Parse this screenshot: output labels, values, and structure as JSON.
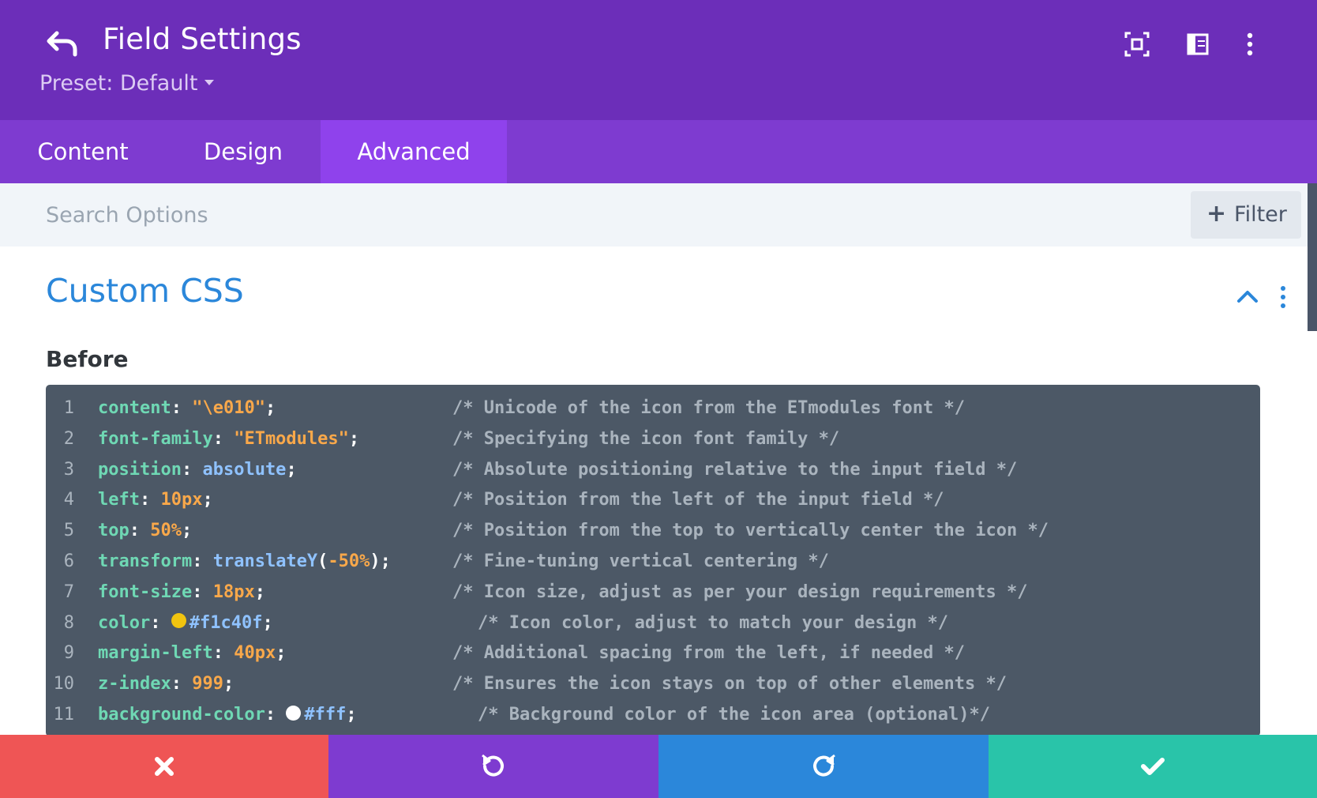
{
  "header": {
    "title": "Field Settings",
    "preset": "Preset: Default",
    "icons": [
      "back-icon",
      "focus-icon",
      "layout-icon",
      "more-icon"
    ]
  },
  "tabs": [
    {
      "label": "Content",
      "active": false
    },
    {
      "label": "Design",
      "active": false
    },
    {
      "label": "Advanced",
      "active": true
    }
  ],
  "search": {
    "placeholder": "Search Options",
    "filter_label": "Filter"
  },
  "section": {
    "title": "Custom CSS",
    "field_label": "Before"
  },
  "code_lines": [
    {
      "num": "1",
      "prop": "content",
      "value": "\"\\e010\"",
      "comment": "/* Unicode of the icon from the ETmodules font */"
    },
    {
      "num": "2",
      "prop": "font-family",
      "value": "\"ETmodules\"",
      "comment": "/* Specifying the icon font family */"
    },
    {
      "num": "3",
      "prop": "position",
      "value": "absolute",
      "comment": "/* Absolute positioning relative to the input field */"
    },
    {
      "num": "4",
      "prop": "left",
      "value": "10px",
      "comment": "/* Position from the left of the input field */"
    },
    {
      "num": "5",
      "prop": "top",
      "value": "50%",
      "comment": "/* Position from the top to vertically center the icon */"
    },
    {
      "num": "6",
      "prop": "transform",
      "value_fn": "translateY",
      "value_arg": "-50%",
      "comment": "/* Fine-tuning vertical centering */"
    },
    {
      "num": "7",
      "prop": "font-size",
      "value": "18px",
      "comment": "/* Icon size, adjust as per your design requirements */"
    },
    {
      "num": "8",
      "prop": "color",
      "value": "#f1c40f",
      "comment": "/* Icon color, adjust to match your design */"
    },
    {
      "num": "9",
      "prop": "margin-left",
      "value": "40px",
      "comment": "/* Additional spacing from the left, if needed */"
    },
    {
      "num": "10",
      "prop": "z-index",
      "value": "999",
      "comment": "/* Ensures the icon stays on top of other elements */"
    },
    {
      "num": "11",
      "prop": "background-color",
      "value": "#fff",
      "comment": "/* Background color of the icon area (optional)*/"
    }
  ],
  "footer": {
    "buttons": [
      {
        "name": "discard",
        "icon": "close-icon",
        "color": "#ef5555"
      },
      {
        "name": "undo",
        "icon": "undo-icon",
        "color": "#7e3bd0"
      },
      {
        "name": "redo",
        "icon": "redo-icon",
        "color": "#2b87da"
      },
      {
        "name": "save",
        "icon": "check-icon",
        "color": "#29c4a9"
      }
    ]
  },
  "colors": {
    "header_bg": "#6c2eb9",
    "tabs_bg": "#7e3bd0",
    "tab_active_bg": "#8f42ec",
    "section_title": "#2b87da",
    "editor_bg": "#4c5866"
  }
}
